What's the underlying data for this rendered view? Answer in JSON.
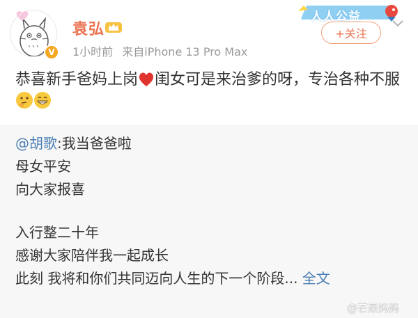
{
  "post": {
    "username": "袁弘",
    "time": "1小时前",
    "source": "来自iPhone 13 Pro Max",
    "verified_badge": "V",
    "follow_label": "+关注",
    "ribbon_text": "人人公益",
    "content": "恭喜新手爸妈上岗",
    "content_after_heart": "闺女可是来治爹的呀，专治各种不服",
    "icons": [
      "avatar-totoro-icon",
      "crown-icon",
      "heart-icon",
      "thinking-emoji-icon",
      "grin-emoji-icon",
      "chevron-down-icon"
    ]
  },
  "repost": {
    "mention": "@胡歌",
    "line1_rest": ":我当爸爸啦",
    "line2": "母女平安",
    "line3": "向大家报喜",
    "line4": "入行整二十年",
    "line5": "感谢大家陪伴我一起成长",
    "line6": "此刻 我将和你们共同迈向人生的下一个阶段...",
    "full_text": "全文"
  },
  "watermark": "@芒果妈妈",
  "colors": {
    "username": "#eb7350",
    "link": "#4a7eb4",
    "meta": "#999999",
    "repost_bg": "#f7f7f7",
    "heart": "#e0342f"
  }
}
